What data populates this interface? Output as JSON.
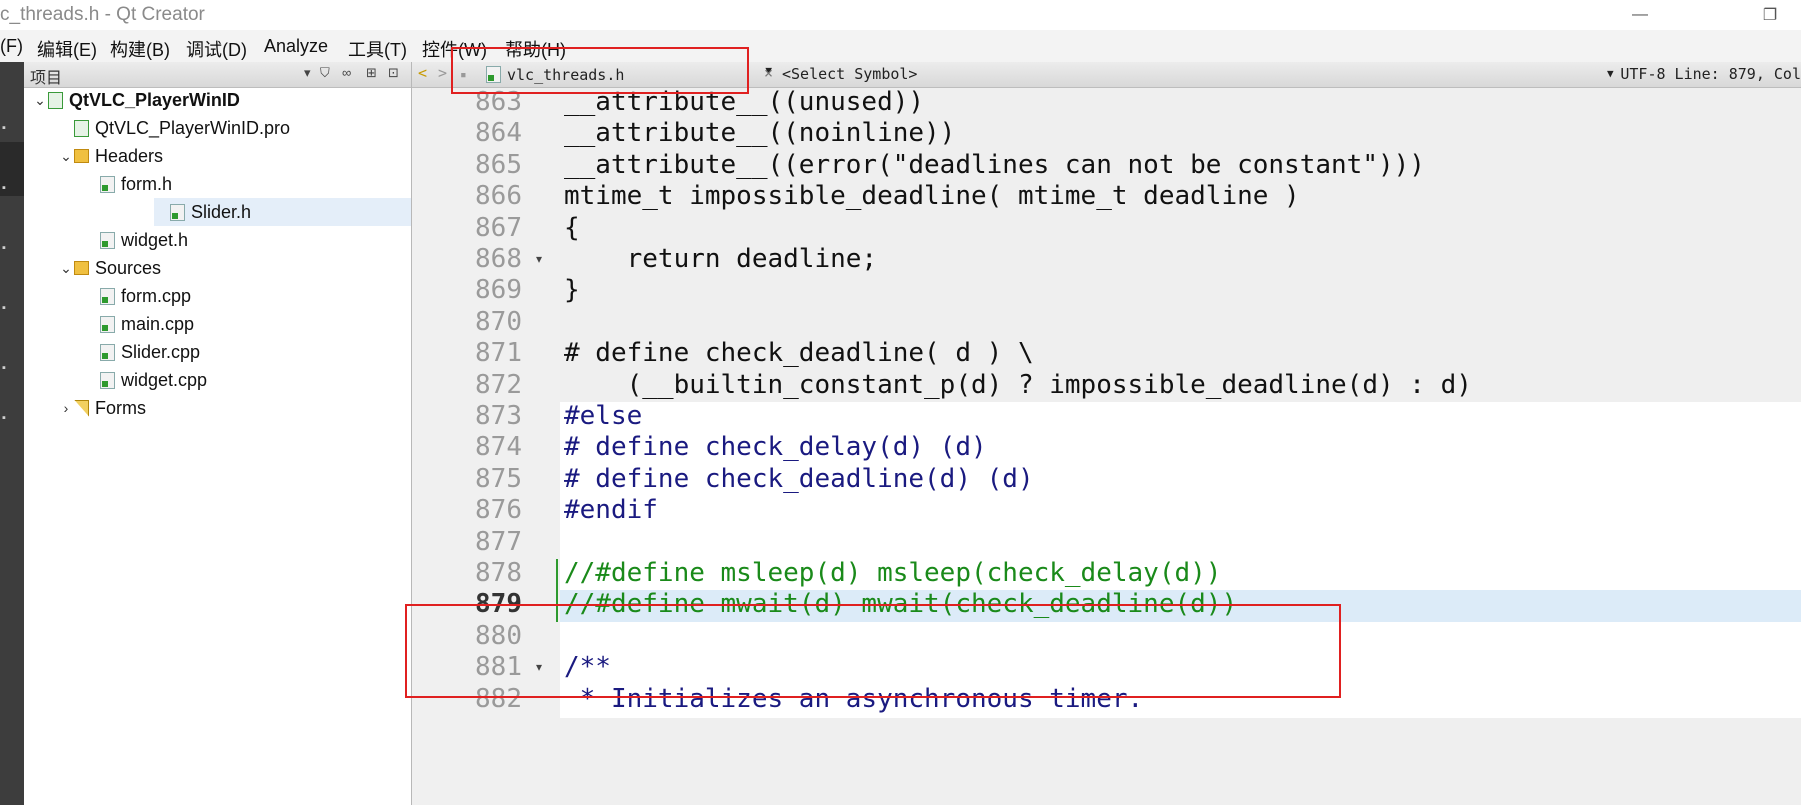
{
  "window": {
    "title": "c_threads.h - Qt Creator",
    "restore_glyph": "❐"
  },
  "menu": [
    "(F)",
    "编辑(E)",
    "构建(B)",
    "调试(D)",
    "Analyze",
    "工具(T)",
    "控件(W)",
    "帮助(H)"
  ],
  "project_panel": {
    "title": "项目",
    "tree": [
      {
        "label": "QtVLC_PlayerWinID",
        "level": 0,
        "kind": "project",
        "expanded": true,
        "bold": true
      },
      {
        "label": "QtVLC_PlayerWinID.pro",
        "level": 1,
        "kind": "pro"
      },
      {
        "label": "Headers",
        "level": 1,
        "kind": "folder",
        "expanded": true
      },
      {
        "label": "form.h",
        "level": 2,
        "kind": "h"
      },
      {
        "label": "Slider.h",
        "level": 2,
        "kind": "h",
        "selected": true
      },
      {
        "label": "widget.h",
        "level": 2,
        "kind": "h"
      },
      {
        "label": "Sources",
        "level": 1,
        "kind": "folder",
        "expanded": true
      },
      {
        "label": "form.cpp",
        "level": 2,
        "kind": "h"
      },
      {
        "label": "main.cpp",
        "level": 2,
        "kind": "h"
      },
      {
        "label": "Slider.cpp",
        "level": 2,
        "kind": "h"
      },
      {
        "label": "widget.cpp",
        "level": 2,
        "kind": "h"
      },
      {
        "label": "Forms",
        "level": 1,
        "kind": "forms",
        "expanded": false
      }
    ]
  },
  "editor": {
    "back_glyph": "<",
    "forward_glyph": ">",
    "file_name": "vlc_threads.h",
    "close_glyph": "×",
    "symbol": "<Select Symbol>",
    "status": "UTF-8 Line: 879, Col",
    "current_line": 879,
    "lines": [
      {
        "n": "863",
        "text": "__attribute__((unused))",
        "style": "plain"
      },
      {
        "n": "864",
        "text": "__attribute__((noinline))",
        "style": "plain"
      },
      {
        "n": "865",
        "text": "__attribute__((error(\"deadlines can not be constant\")))",
        "style": "plain"
      },
      {
        "n": "866",
        "text": "mtime_t impossible_deadline( mtime_t deadline )",
        "style": "plain"
      },
      {
        "n": "867",
        "text": "{",
        "style": "plain"
      },
      {
        "n": "868",
        "text": "    return deadline;",
        "style": "plain",
        "fold": true
      },
      {
        "n": "869",
        "text": "}",
        "style": "plain"
      },
      {
        "n": "870",
        "text": "",
        "style": "plain"
      },
      {
        "n": "871",
        "text": "# define check_deadline( d ) \\",
        "style": "plain"
      },
      {
        "n": "872",
        "text": "    (__builtin_constant_p(d) ? impossible_deadline(d) : d)",
        "style": "plain"
      },
      {
        "n": "873",
        "text": "#else",
        "style": "directive"
      },
      {
        "n": "874",
        "text": "# define check_delay(d) (d)",
        "style": "directive"
      },
      {
        "n": "875",
        "text": "# define check_deadline(d) (d)",
        "style": "directive"
      },
      {
        "n": "876",
        "text": "#endif",
        "style": "directive"
      },
      {
        "n": "877",
        "text": "",
        "style": "directive"
      },
      {
        "n": "878",
        "text": "//#define msleep(d) msleep(check_delay(d))",
        "style": "comment"
      },
      {
        "n": "879",
        "text": "//#define mwait(d) mwait(check_deadline(d))",
        "style": "comment"
      },
      {
        "n": "880",
        "text": "",
        "style": "directive"
      },
      {
        "n": "881",
        "text": "/**",
        "style": "doc",
        "fold": true
      },
      {
        "n": "882",
        "text": " * Initializes an asynchronous timer.",
        "style": "doc"
      }
    ]
  },
  "colors": {
    "code_plain": "#111111",
    "code_directive": "#1a1a80",
    "code_comment": "#1a8a1a",
    "code_doc": "#1a1a80",
    "inactive_bg": "#efefef",
    "active_bg": "#ffffff",
    "current_line_bg": "#dcebf8",
    "highlight_box": "#e02020"
  }
}
